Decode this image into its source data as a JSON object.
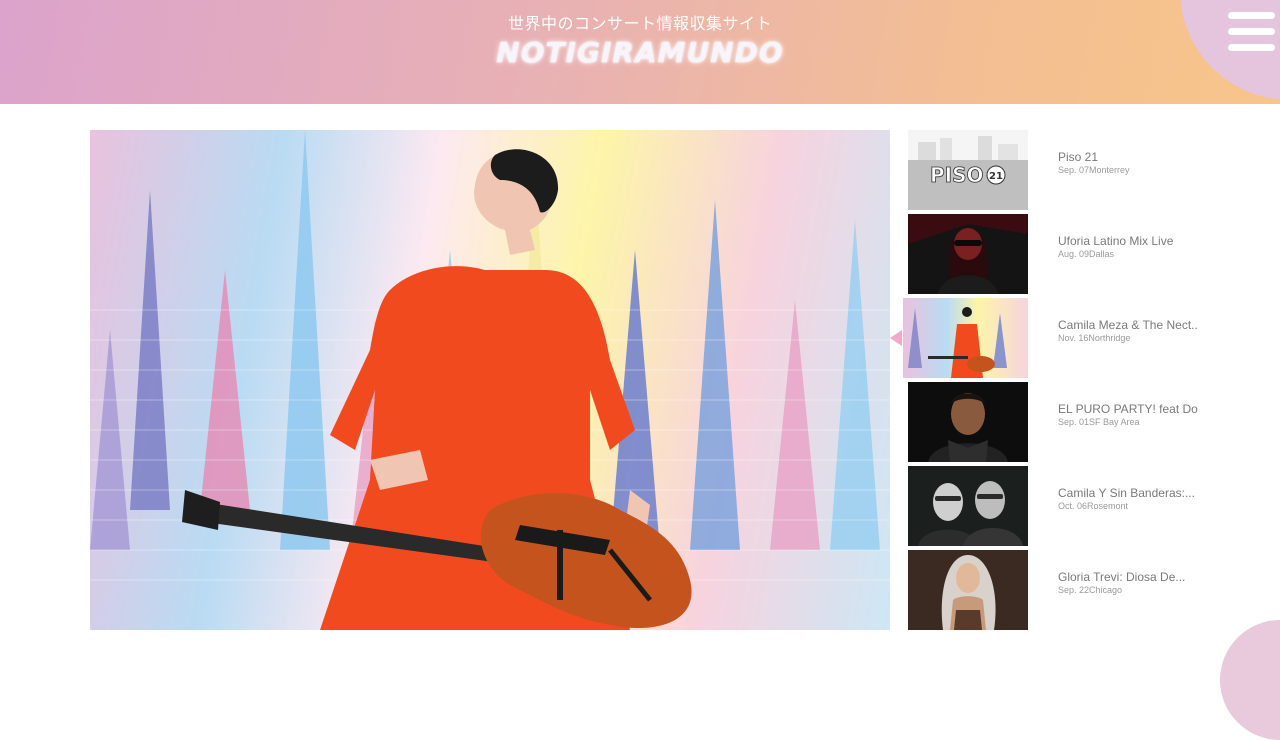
{
  "header": {
    "tagline": "世界中のコンサート情報収集サイト",
    "logo": "NOTIGIRAMUNDO",
    "menu_icon": "hamburger-icon"
  },
  "hero": {
    "alt": "Camila Meza & The Nect..."
  },
  "events": [
    {
      "title": "Piso 21",
      "date": "Sep. 07",
      "city": "Monterrey",
      "active": false,
      "thumb": "piso21"
    },
    {
      "title": "Uforia Latino Mix Live",
      "date": "Aug. 09",
      "city": "Dallas",
      "active": false,
      "thumb": "uforia"
    },
    {
      "title": "Camila Meza & The Nect..",
      "date": "Nov. 16",
      "city": "Northridge",
      "active": true,
      "thumb": "camila"
    },
    {
      "title": "EL PURO PARTY! feat Do..",
      "date": "Sep. 01",
      "city": "SF Bay Area",
      "active": false,
      "thumb": "elpuro"
    },
    {
      "title": "Camila Y Sin Banderas:...",
      "date": "Oct. 06",
      "city": "Rosemont",
      "active": false,
      "thumb": "camilay"
    },
    {
      "title": "Gloria Trevi: Diosa De...",
      "date": "Sep. 22",
      "city": "Chicago",
      "active": false,
      "thumb": "gloria"
    }
  ],
  "colors": {
    "header_start": "#dca3cc",
    "header_end": "#f7c58a",
    "pointer": "#f3a7c9"
  }
}
